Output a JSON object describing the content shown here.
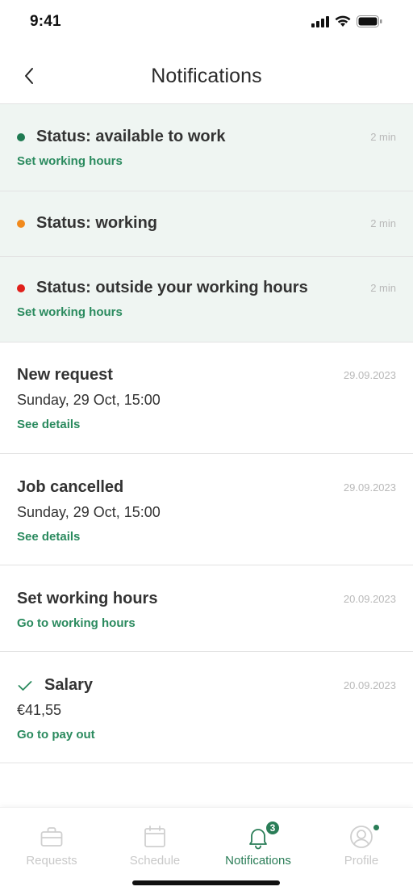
{
  "status_bar": {
    "time": "9:41"
  },
  "header": {
    "title": "Notifications",
    "back_icon": "chevron-left-icon"
  },
  "notifications": [
    {
      "title": "Status: available to work",
      "time": "2 min",
      "link": "Set working hours",
      "dot_color": "#1f7a52"
    },
    {
      "title": "Status: working",
      "time": "2 min",
      "dot_color": "#f18a1c"
    },
    {
      "title": "Status: outside your working hours",
      "time": "2 min",
      "link": "Set working hours",
      "dot_color": "#e0201b"
    },
    {
      "title": "New request",
      "time": "29.09.2023",
      "subtitle": "Sunday, 29 Oct, 15:00",
      "link": "See details"
    },
    {
      "title": "Job cancelled",
      "time": "29.09.2023",
      "subtitle": "Sunday, 29 Oct, 15:00",
      "link": "See details"
    },
    {
      "title": "Set working hours",
      "time": "20.09.2023",
      "link": "Go to working hours"
    },
    {
      "title": "Salary",
      "time": "20.09.2023",
      "subtitle": "€41,55",
      "link": "Go to pay out",
      "icon": "check-icon"
    }
  ],
  "tab_bar": {
    "tabs": [
      {
        "label": "Requests",
        "icon": "briefcase-icon"
      },
      {
        "label": "Schedule",
        "icon": "calendar-icon"
      },
      {
        "label": "Notifications",
        "icon": "bell-icon",
        "badge": "3",
        "active": true
      },
      {
        "label": "Profile",
        "icon": "profile-icon"
      }
    ]
  },
  "colors": {
    "accent": "#2a8a5e",
    "highlight_bg": "#eff5f2",
    "inactive": "#c9c9c9"
  }
}
